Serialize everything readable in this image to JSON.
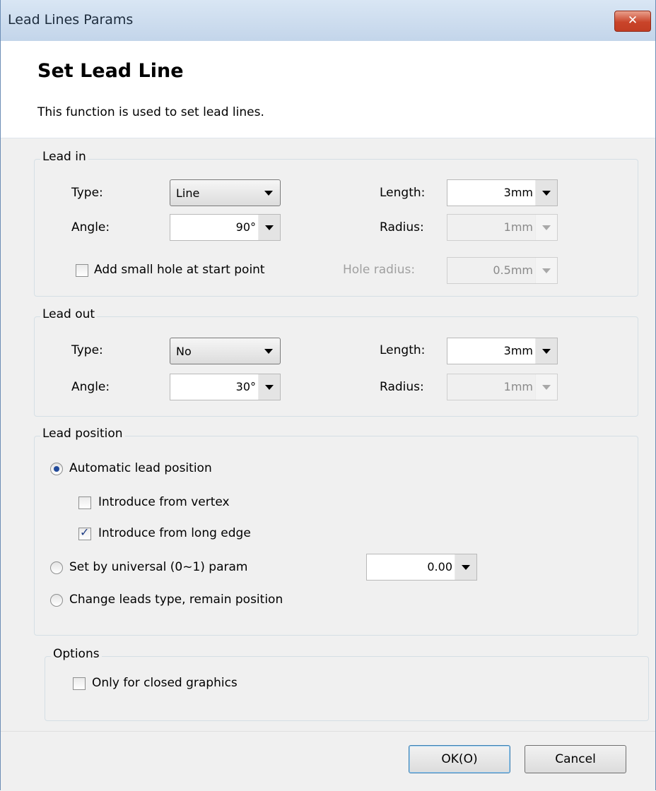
{
  "window": {
    "title": "Lead Lines Params",
    "close_glyph": "✕"
  },
  "header": {
    "title": "Set Lead Line",
    "description": "This function is used to set lead lines."
  },
  "lead_in": {
    "legend": "Lead in",
    "type_label": "Type:",
    "type_value": "Line",
    "angle_label": "Angle:",
    "angle_value": "90°",
    "length_label": "Length:",
    "length_value": "3mm",
    "radius_label": "Radius:",
    "radius_value": "1mm",
    "radius_enabled": false,
    "hole_checkbox_label": "Add small hole at start point",
    "hole_checked": false,
    "hole_radius_label": "Hole radius:",
    "hole_radius_value": "0.5mm",
    "hole_radius_enabled": false
  },
  "lead_out": {
    "legend": "Lead out",
    "type_label": "Type:",
    "type_value": "No",
    "angle_label": "Angle:",
    "angle_value": "30°",
    "length_label": "Length:",
    "length_value": "3mm",
    "radius_label": "Radius:",
    "radius_value": "1mm",
    "radius_enabled": false
  },
  "lead_position": {
    "legend": "Lead position",
    "auto_label": "Automatic lead position",
    "auto_selected": true,
    "vertex_label": "Introduce from vertex",
    "vertex_checked": false,
    "long_edge_label": "Introduce from long edge",
    "long_edge_checked": true,
    "universal_label": "Set by universal (0~1) param",
    "universal_selected": false,
    "universal_value": "0.00",
    "change_label": "Change leads type, remain position",
    "change_selected": false
  },
  "options": {
    "legend": "Options",
    "closed_only_label": "Only for closed graphics",
    "closed_only_checked": false
  },
  "buttons": {
    "ok": "OK(O)",
    "cancel": "Cancel"
  },
  "check_glyph": "✓"
}
